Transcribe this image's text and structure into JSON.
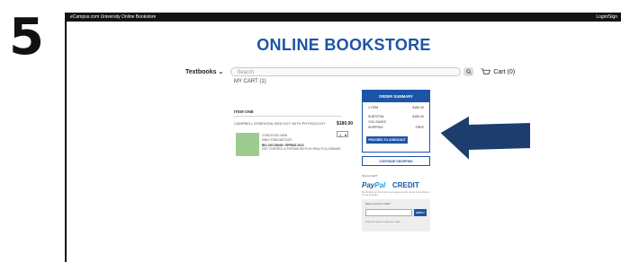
{
  "step_number": "5",
  "topbar": {
    "site": "eCampus.com University Online Bookstore",
    "login": "Login/Sign"
  },
  "header": {
    "logo": "ONLINE BOOKSTORE"
  },
  "nav": {
    "textbooks_label": "Textbooks",
    "search_placeholder": "Search",
    "cart_label": "Cart (0)"
  },
  "cart": {
    "title": "MY CART (1)",
    "item_heading": "ITEM ONE",
    "item": {
      "title": "CAMPBELL ESSENTIAL BIOLOGY WITH PHYSIOLOGY",
      "price": "$180.00",
      "qty": "1",
      "condition": "CONDITION: NEW",
      "isbn": "ISBN: 9780134573472",
      "course": "BIO 200 DRUM / SPRING 2022",
      "course_note": "GET CONTROL & PURSUE BOTH IN HEALTH & DISEASE"
    }
  },
  "summary": {
    "title": "ORDER SUMMARY",
    "rows": [
      {
        "label": "1 ITEM",
        "value": "$180.00"
      },
      {
        "label": "SUBTOTAL",
        "value": "$180.00"
      },
      {
        "label": "YOU SAVED",
        "value": ""
      },
      {
        "label": "SHIPPING",
        "value": "FREE"
      }
    ],
    "checkout_label": "PROCEED TO CHECKOUT"
  },
  "continue_label": "CONTINUE SHOPPING",
  "payments": {
    "we_accept": "WE ACCEPT",
    "paypal_a": "Pay",
    "paypal_b": "Pal",
    "credit": "CREDIT",
    "note": "By clicking on the button you agree to the terms & conditions of the provider."
  },
  "promo": {
    "label": "Have a promo code?",
    "apply": "APPLY",
    "note": "Only one promo code per order."
  },
  "colors": {
    "brand": "#1d54a6",
    "arrow": "#1d3d6e"
  }
}
